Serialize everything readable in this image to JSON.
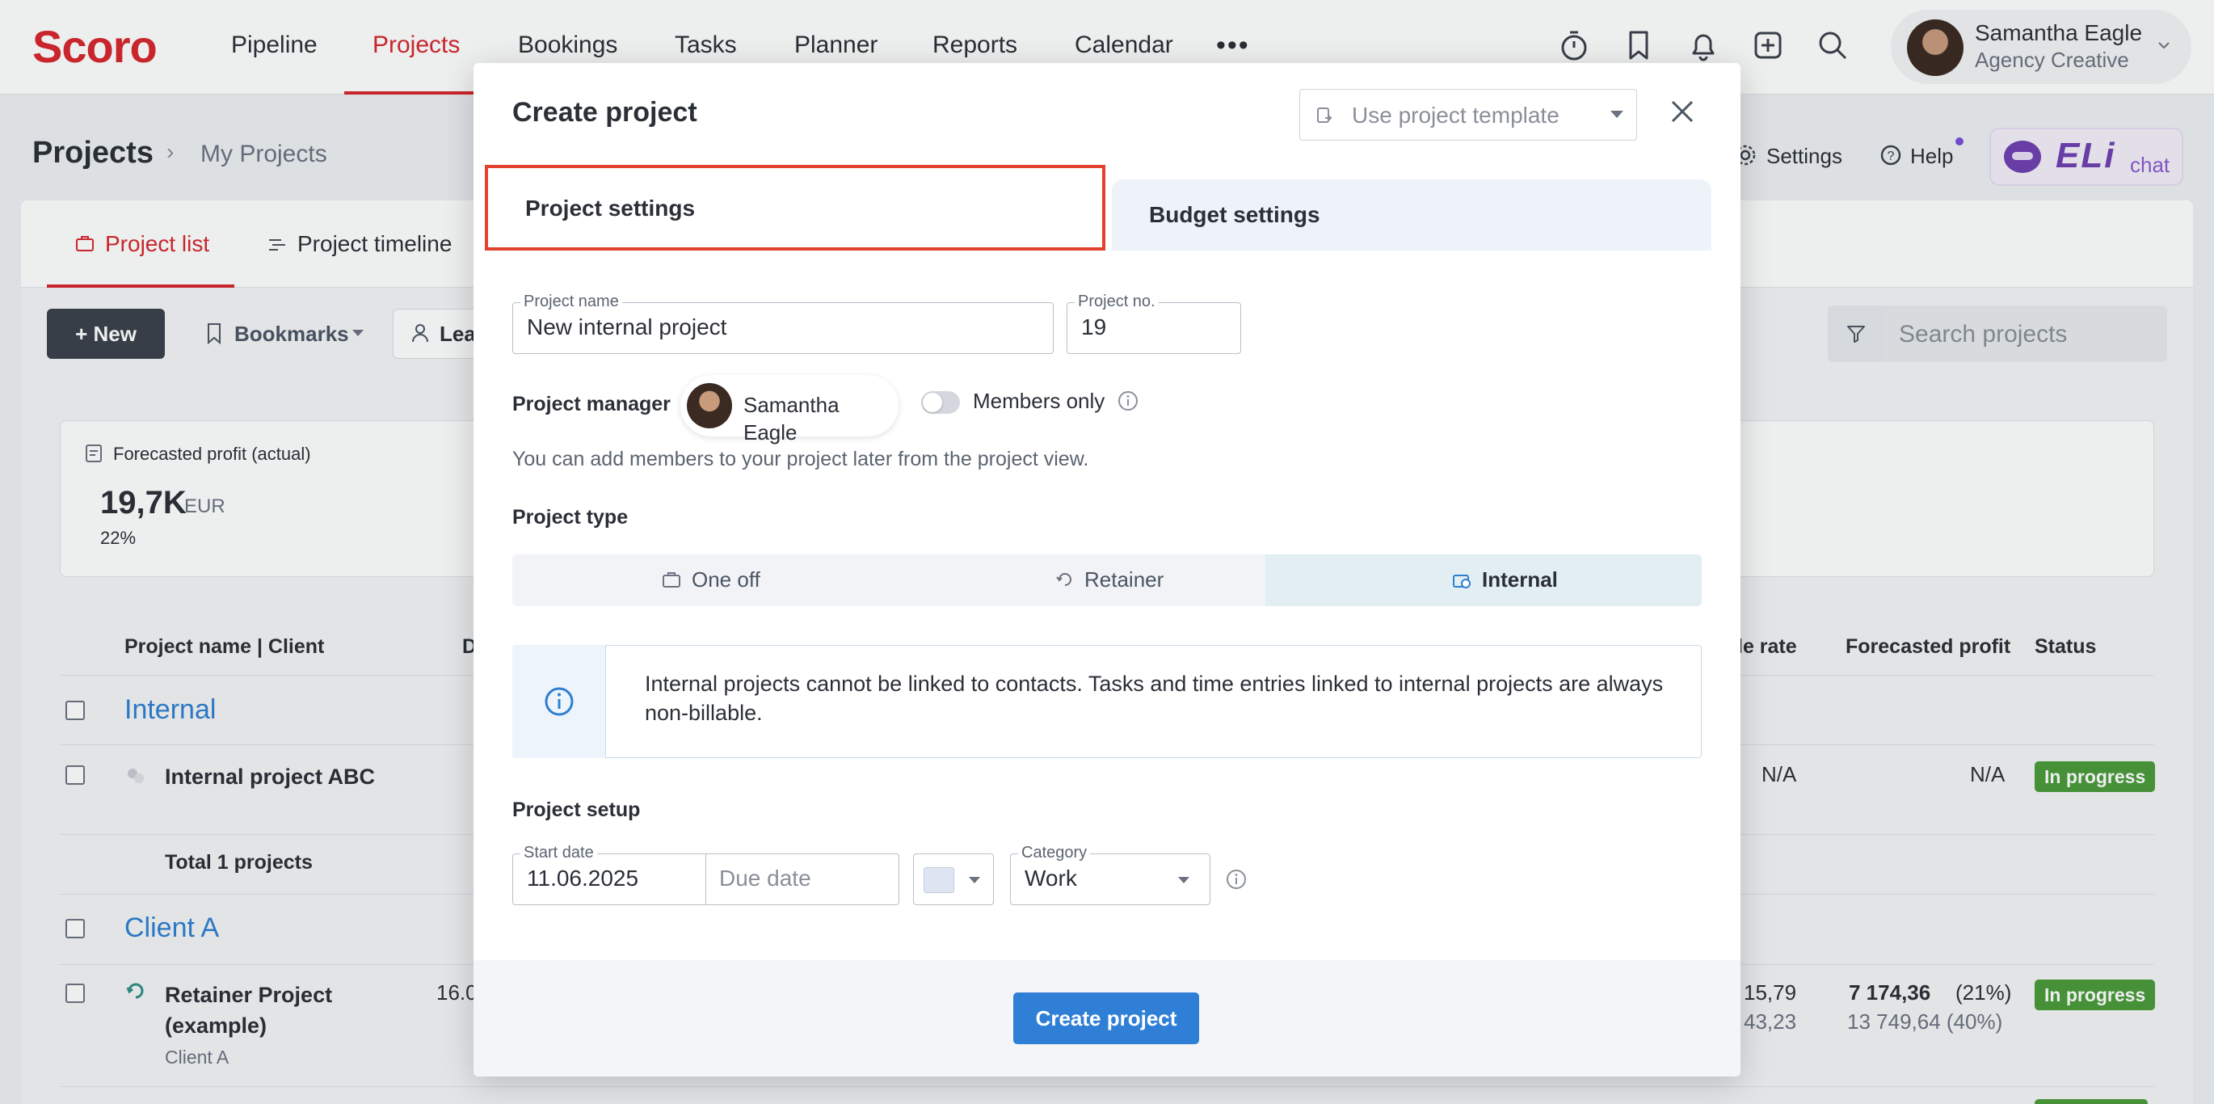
{
  "nav": {
    "logo": "Scoro",
    "items": [
      "Pipeline",
      "Projects",
      "Bookings",
      "Tasks",
      "Planner",
      "Reports",
      "Calendar"
    ],
    "more": "•••",
    "user_name": "Samantha Eagle",
    "user_role": "Agency Creative"
  },
  "header": {
    "title": "Projects",
    "separator": "›",
    "subtitle": "My Projects",
    "settings": "Settings",
    "help": "Help",
    "eli": "ELi",
    "eli_chat": "chat"
  },
  "tabs": {
    "list": "Project list",
    "timeline": "Project timeline"
  },
  "toolbar": {
    "new": "+ New",
    "bookmarks": "Bookmarks",
    "lead": "Lea",
    "search_placeholder": "Search projects"
  },
  "kpi": {
    "title": "Forecasted profit (actual)",
    "value": "19,7K",
    "unit": "EUR",
    "pct": "22%"
  },
  "table": {
    "headers": {
      "name": "Project name | Client",
      "d": "D",
      "rate": "le rate",
      "profit": "Forecasted profit",
      "status": "Status"
    },
    "groups": [
      {
        "title": "Internal"
      },
      {
        "title": "Client A"
      }
    ],
    "rows": [
      {
        "name": "Internal project ABC",
        "rate": "N/A",
        "profit": "N/A",
        "status": "In progress"
      },
      {
        "name_line1": "Retainer Project",
        "name_line2": "(example)",
        "client": "Client A",
        "date": "16.0",
        "rate1": "15,79",
        "rate2": "43,23",
        "profit_main": "7 174,36",
        "profit_pct": "(21%)",
        "profit_sub": "13 749,64 (40%)",
        "status": "In progress"
      }
    ],
    "total": "Total 1 projects"
  },
  "modal": {
    "title": "Create project",
    "template_placeholder": "Use project template",
    "tab_settings": "Project settings",
    "tab_budget": "Budget settings",
    "name_label": "Project name",
    "name_value": "New internal project",
    "no_label": "Project no.",
    "no_value": "19",
    "manager_label": "Project manager",
    "manager_name": "Samantha Eagle",
    "members_only": "Members only",
    "hint": "You can add members to your project later from the project view.",
    "type_label": "Project type",
    "types": [
      "One off",
      "Retainer",
      "Internal"
    ],
    "info_text": "Internal projects cannot be linked to contacts. Tasks and time entries linked to internal projects are always non-billable.",
    "setup_label": "Project setup",
    "start_label": "Start date",
    "start_value": "11.06.2025",
    "due_placeholder": "Due date",
    "category_label": "Category",
    "category_value": "Work",
    "create_button": "Create project"
  }
}
